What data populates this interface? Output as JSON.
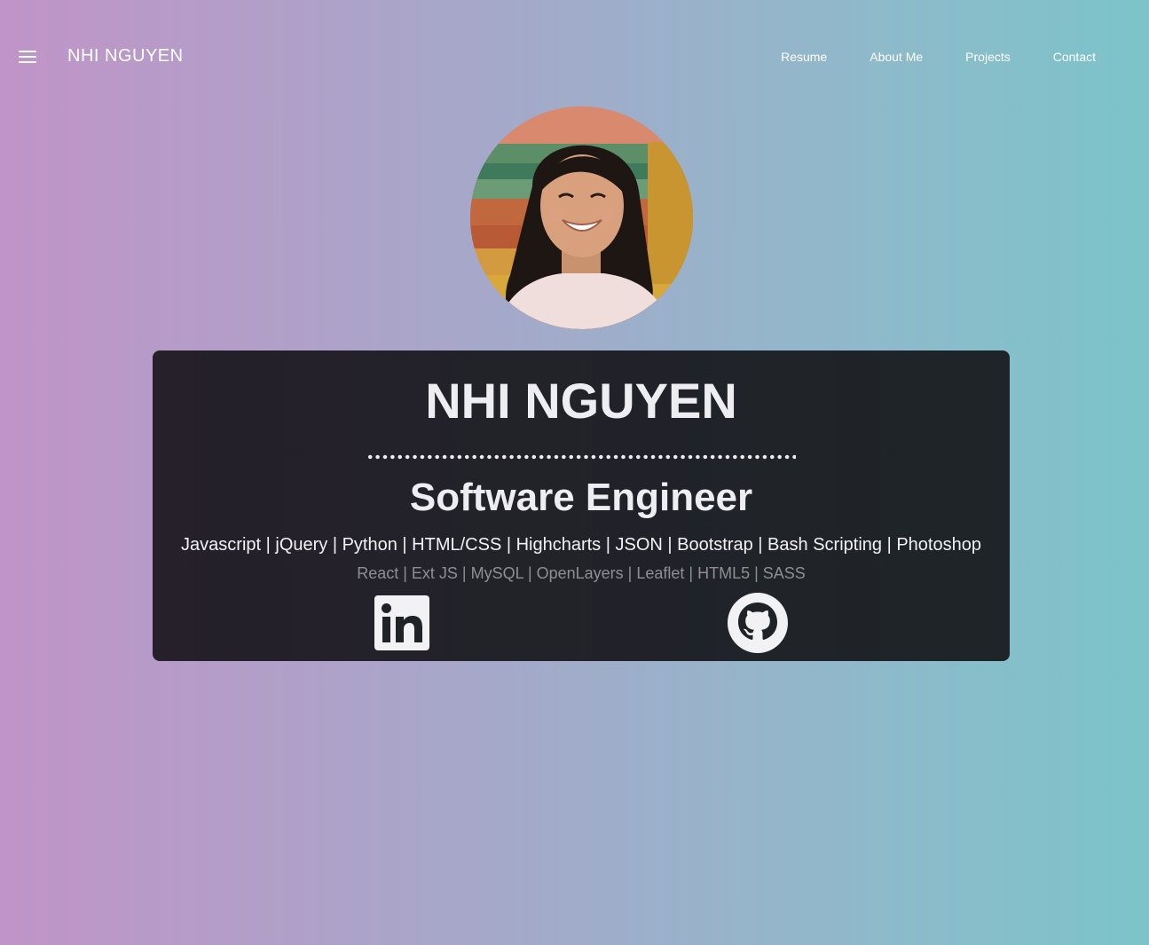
{
  "nav": {
    "brand": "NHI NGUYEN",
    "links": [
      "Resume",
      "About Me",
      "Projects",
      "Contact"
    ]
  },
  "hero": {
    "name": "NHI NGUYEN",
    "title": "Software Engineer",
    "skills_primary": "Javascript | jQuery | Python | HTML/CSS | Highcharts | JSON | Bootstrap | Bash Scripting | Photoshop",
    "skills_secondary": "React | Ext JS | MySQL | OpenLayers | Leaflet | HTML5 | SASS"
  },
  "social": {
    "linkedin_icon": "linkedin-icon",
    "github_icon": "github-icon"
  },
  "colors": {
    "gradient_left": "#c094c8",
    "gradient_right": "#7cc4c9",
    "card_bg": "#1f2328",
    "text_primary": "#eeeef2",
    "text_secondary": "#8e8f94"
  }
}
